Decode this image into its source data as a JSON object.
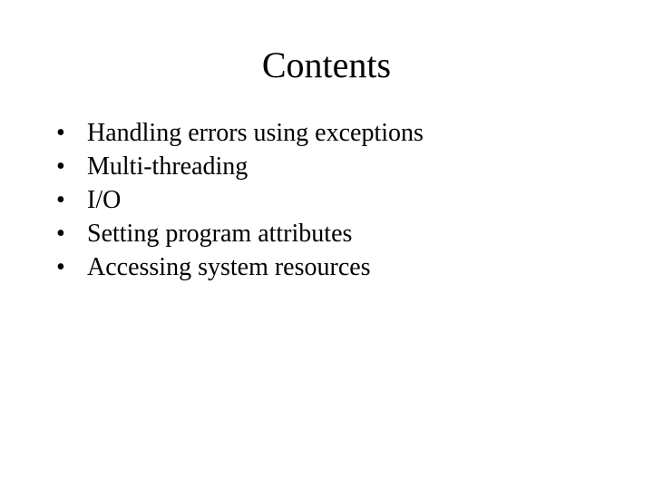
{
  "title": "Contents",
  "bullet_char": "•",
  "items": [
    "Handling errors using exceptions",
    "Multi-threading",
    "I/O",
    "Setting program attributes",
    "Accessing system resources"
  ]
}
